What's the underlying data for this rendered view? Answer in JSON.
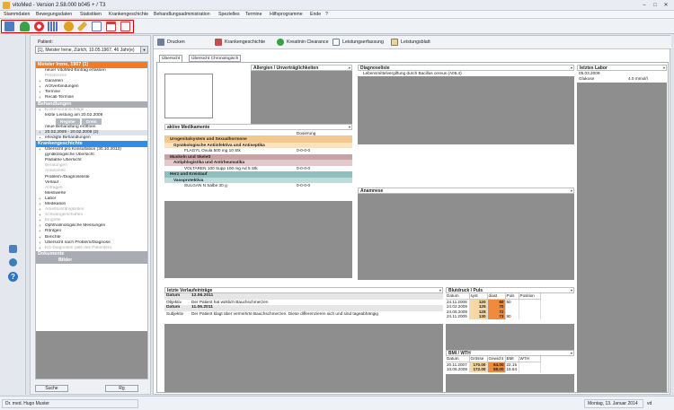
{
  "window": {
    "title": "vitoMed - Version 2.58.000 b045 + / T3",
    "minimize": "–",
    "maximize": "□",
    "close": "✕"
  },
  "menu": [
    "Stammdaten",
    "Bewegungsdaten",
    "Statistiken",
    "Krankengeschichte",
    "Behandlungsadministration",
    "Spezielles",
    "Termine",
    "Hilfsprogramme",
    "Ende",
    "?"
  ],
  "toolbar_icons": [
    "list-icon",
    "person-icon",
    "lifebuoy-icon",
    "calendar-grid-icon",
    "pill-icon",
    "syringe-icon",
    "document-icon",
    "calendar-icon",
    "export-icon"
  ],
  "patient": {
    "label": "Patient:",
    "value": "[1], Meister Irene, Zürich, 10.05.1967, 46 Jahr(e)"
  },
  "nav": {
    "patient_header": "Meister Irene, 1967 (1)",
    "patient_items": [
      {
        "t": "neuer VitoMed-Eintrag erfassen",
        "exp": false,
        "g": false
      },
      {
        "t": "Pendenzen",
        "exp": false,
        "g": true
      },
      {
        "t": "Garanten",
        "exp": true,
        "g": false
      },
      {
        "t": "Arztverbindungen",
        "exp": true,
        "g": false
      },
      {
        "t": "Termine",
        "exp": true,
        "g": false
      },
      {
        "t": "Recall-Termine",
        "exp": true,
        "g": false
      }
    ],
    "treatments_header": "Behandlungen",
    "treatment_items_top": [
      {
        "t": "Kostenvoranschläge",
        "exp": true,
        "g": true
      },
      {
        "t": "letzte Leistung am 20.02.2009",
        "exp": false,
        "g": false
      }
    ],
    "treatment_subtabs": [
      "Regime",
      "Grein"
    ],
    "treatment_items_bottom": [
      {
        "t": "neue Behandlung eröffnen",
        "exp": false,
        "g": false,
        "hl": false
      },
      {
        "t": "20.02.2009 - 20.02.2009 (2)",
        "exp": true,
        "g": false,
        "hl": true
      },
      {
        "t": "erledigte Behandlungen",
        "exp": true,
        "g": false,
        "hl": false
      }
    ],
    "history_header": "Krankengeschichte",
    "history_items": [
      {
        "t": "Übersicht pro Konsultation (30.10.2013)",
        "exp": true,
        "g": false
      },
      {
        "t": "gynäkologische Übersicht",
        "exp": false,
        "g": false
      },
      {
        "t": "Pädiatrie Übersicht",
        "exp": false,
        "g": false
      },
      {
        "t": "Beratungen",
        "exp": false,
        "g": true
      },
      {
        "t": "Anamnese",
        "exp": false,
        "g": true
      },
      {
        "t": "Problem-/Diagnoseliste",
        "exp": false,
        "g": false
      },
      {
        "t": "Verlauf",
        "exp": false,
        "g": false
      },
      {
        "t": "Anfragen",
        "exp": false,
        "g": true
      },
      {
        "t": "Messwerte",
        "exp": false,
        "g": false
      },
      {
        "t": "Labor",
        "exp": true,
        "g": false
      },
      {
        "t": "Medikation",
        "exp": true,
        "g": false
      },
      {
        "t": "Arbeitsunfähigkeiten",
        "exp": true,
        "g": true
      },
      {
        "t": "Schwangerschaften",
        "exp": true,
        "g": true
      },
      {
        "t": "Eingriffe",
        "exp": true,
        "g": true
      },
      {
        "t": "Ophthalmologische Messungen",
        "exp": true,
        "g": false
      },
      {
        "t": "Röntgen",
        "exp": true,
        "g": false
      },
      {
        "t": "Berichte",
        "exp": true,
        "g": false
      },
      {
        "t": "Übersicht nach Problem/Diagnose",
        "exp": true,
        "g": false
      },
      {
        "t": "KG-Diagnosen (alle des Patienten)",
        "exp": true,
        "g": true
      }
    ],
    "documents_header": "Dokumente",
    "images_header": "Bilder",
    "search_button": "Suche",
    "go_button": "Rg"
  },
  "content_toolbar": [
    {
      "label": "Drucken",
      "icon": "printer-icon"
    },
    {
      "label": "Krankengeschichte",
      "icon": "book-icon"
    },
    {
      "label": "Kreatinin Clearance",
      "icon": "kidney-icon"
    },
    {
      "label": "Leistungserfassung",
      "icon": "form-icon"
    },
    {
      "label": "Leistungsblatt",
      "icon": "sheet-icon"
    }
  ],
  "view_tabs": [
    "Übersicht",
    "Übersicht Chronologisch"
  ],
  "panels": {
    "allergies": {
      "title": "Allergien / Unverträglichkeiten"
    },
    "diagnoses": {
      "title": "Diagnoseliste",
      "items": [
        "Lebensmittelvergiftung durch Bacillus cereus (A05.4)"
      ]
    },
    "lab": {
      "title": "letztes Labor",
      "date": "05.03.2009",
      "rows": [
        {
          "name": "Glukose",
          "value": "4.0 mmol/l"
        }
      ]
    },
    "meds": {
      "title": "aktive Medikamente",
      "col_dosage": "Dosierung",
      "rows": [
        {
          "kind": "group",
          "text": "Urogenitalsystem und Sexualhormone",
          "color": "#f3c98e"
        },
        {
          "kind": "sub",
          "text": "Gynäkologische Antiinfektiva und Antiseptika",
          "color": "#fbe2bd"
        },
        {
          "kind": "drug",
          "text": "FLAGYL Ovula 500 mg 10 Stk",
          "dose": "0-0-0-0"
        },
        {
          "kind": "group",
          "text": "Muskeln und Skelett",
          "color": "#c7a3a6"
        },
        {
          "kind": "sub",
          "text": "Antiphlogistika und Antirheumatika",
          "color": "#e3c9cb"
        },
        {
          "kind": "drug",
          "text": "VOLTAREN 100 Supp 100 mg Ad 5 Stk",
          "dose": "0-0-0-0"
        },
        {
          "kind": "group",
          "text": "Herz und Kreislauf",
          "color": "#8fbfbf"
        },
        {
          "kind": "sub",
          "text": "Vasoprotektiva",
          "color": "#bfdcdc"
        },
        {
          "kind": "drug",
          "text": "SULGAN N Salbe 30 g",
          "dose": "0-0-0-0"
        }
      ]
    },
    "anamnesis": {
      "title": "Anamnese"
    },
    "history": {
      "title": "letzte Verlaufeinträge",
      "entries": [
        {
          "date_label": "Datum",
          "date": "12.06.2011",
          "kind": "Objektiv",
          "text": "Der Patient hat wirklich Bauchschmerzen"
        },
        {
          "date_label": "Datum",
          "date": "11.06.2011",
          "kind": "Subjektiv",
          "text": "Der Patient klagt über vermehrte Bauchschmerzen. Diese differenzieren sich und sind tageabhängig"
        }
      ]
    },
    "bp": {
      "title": "Blutdruck / Puls",
      "headers": [
        "Datum",
        "syst",
        "diast",
        "Puls",
        "Position"
      ],
      "rows": [
        [
          "24.11.2008",
          "120",
          "60",
          "50",
          ""
        ],
        [
          "24.02.2009",
          "125",
          "70",
          "",
          ""
        ],
        [
          "24.06.2009",
          "128",
          "72",
          "",
          ""
        ],
        [
          "24.11.2009",
          "130",
          "73",
          "90",
          ""
        ]
      ]
    },
    "bmi": {
      "title": "BMI / WTH",
      "headers": [
        "Datum",
        "Grösse",
        "Gewicht",
        "BMI",
        "WTH"
      ],
      "rows": [
        [
          "20.11.2007",
          "170.00",
          "64.00",
          "22.15",
          ""
        ],
        [
          "10.06.2009",
          "172.00",
          "58.00",
          "19.84",
          ""
        ]
      ]
    }
  },
  "status": {
    "user": "Dr. med. Hugo Muster",
    "date": "Montag, 13. Januar 2014",
    "tag": "vd"
  },
  "colors": {
    "orange": "#f47a22",
    "blue": "#2f8fe8",
    "gray": "#a9adb3",
    "panel_bg": "#8e8e8e",
    "frame_red": "#cc0000"
  }
}
